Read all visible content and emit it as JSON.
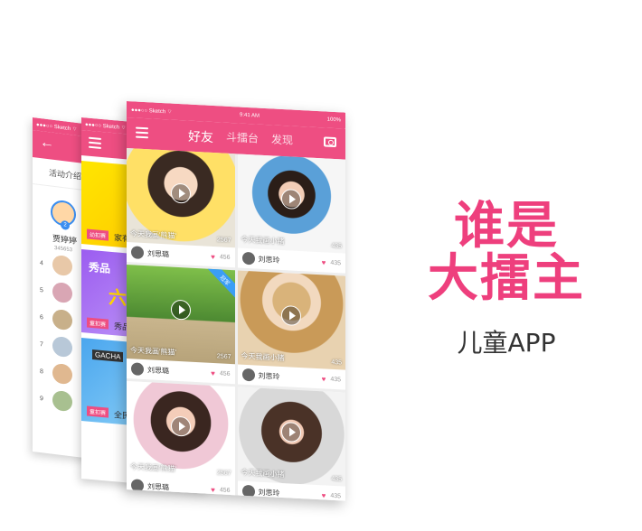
{
  "back_screen": {
    "status": "●●●○○ Sketch  ⌔",
    "back_icon": "arrow-left-icon",
    "subtitle": "活动介绍",
    "top_user": {
      "rank": "2",
      "name": "贾婷婷",
      "number": "345653"
    },
    "rows": [
      "4",
      "5",
      "6",
      "7",
      "8",
      "9"
    ]
  },
  "mid_screen": {
    "status": "●●●○○ Sketch  ⌔",
    "banners": [
      {
        "tag": "幼扣赛",
        "caption": "家有"
      },
      {
        "tag": "童扣赛",
        "caption": "秀品",
        "title_small": "秀品",
        "title_big": "六一",
        "sub": "六一儿"
      },
      {
        "tag": "童扣赛",
        "caption": "全民",
        "title_small": "GACHA"
      }
    ]
  },
  "front_screen": {
    "status_left": "●●●○○ Sketch  ⌔",
    "status_time": "9:41 AM",
    "status_right": "100%",
    "tabs": [
      {
        "label": "好友",
        "active": true
      },
      {
        "label": "斗擂台",
        "active": false
      },
      {
        "label": "发现",
        "active": false
      }
    ],
    "cards": [
      {
        "title": "今天我画'熊猫'",
        "views": "2567",
        "user": "刘思璐",
        "likes": "456"
      },
      {
        "title": "今天我画小猪",
        "views": "435",
        "user": "刘思玲",
        "likes": "435"
      },
      {
        "title": "今天我画'熊猫'",
        "views": "2567",
        "user": "刘思璐",
        "likes": "456",
        "ribbon": "冠军"
      },
      {
        "title": "今天我画小猪",
        "views": "435",
        "user": "刘思玲",
        "likes": "435"
      },
      {
        "title": "今天我画'熊猫'",
        "views": "2567",
        "user": "刘思璐",
        "likes": "456"
      },
      {
        "title": "今天我画小猪",
        "views": "435",
        "user": "刘思玲",
        "likes": "435"
      }
    ]
  },
  "hero": {
    "line1": "谁是",
    "line2": "大擂主",
    "subtitle": "儿童APP"
  },
  "colors": {
    "accent": "#ee4e82",
    "hero": "#ee3f7d"
  }
}
